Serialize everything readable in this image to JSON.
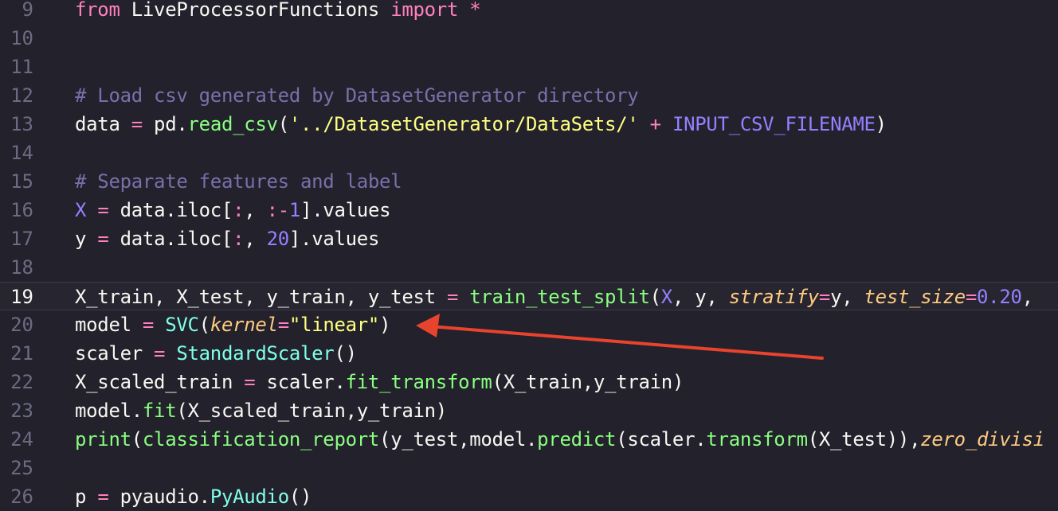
{
  "editor": {
    "lines": [
      {
        "n": "9",
        "tokens": [
          [
            "kw",
            "from"
          ],
          [
            "plain",
            " LiveProcessorFunctions "
          ],
          [
            "kw",
            "import"
          ],
          [
            "plain",
            " "
          ],
          [
            "op",
            "*"
          ]
        ]
      },
      {
        "n": "10",
        "tokens": []
      },
      {
        "n": "11",
        "tokens": []
      },
      {
        "n": "12",
        "tokens": [
          [
            "cmt",
            "# Load csv generated by DatasetGenerator directory"
          ]
        ]
      },
      {
        "n": "13",
        "tokens": [
          [
            "plain",
            "data "
          ],
          [
            "op",
            "="
          ],
          [
            "plain",
            " pd."
          ],
          [
            "fn",
            "read_csv"
          ],
          [
            "plain",
            "("
          ],
          [
            "str",
            "'../DatasetGenerator/DataSets/'"
          ],
          [
            "plain",
            " "
          ],
          [
            "op",
            "+"
          ],
          [
            "plain",
            " "
          ],
          [
            "var",
            "INPUT_CSV_FILENAME"
          ],
          [
            "plain",
            ")"
          ]
        ]
      },
      {
        "n": "14",
        "tokens": []
      },
      {
        "n": "15",
        "tokens": [
          [
            "cmt",
            "# Separate features and label"
          ]
        ]
      },
      {
        "n": "16",
        "tokens": [
          [
            "var",
            "X"
          ],
          [
            "plain",
            " "
          ],
          [
            "op",
            "="
          ],
          [
            "plain",
            " data.iloc["
          ],
          [
            "op",
            ":"
          ],
          [
            "plain",
            ", "
          ],
          [
            "op",
            ":-"
          ],
          [
            "num",
            "1"
          ],
          [
            "plain",
            "].values"
          ]
        ]
      },
      {
        "n": "17",
        "tokens": [
          [
            "plain",
            "y "
          ],
          [
            "op",
            "="
          ],
          [
            "plain",
            " data.iloc["
          ],
          [
            "op",
            ":"
          ],
          [
            "plain",
            ", "
          ],
          [
            "num",
            "20"
          ],
          [
            "plain",
            "].values"
          ]
        ]
      },
      {
        "n": "18",
        "tokens": []
      },
      {
        "n": "19",
        "current": true,
        "tokens": [
          [
            "plain",
            "X_train, X_test, y_train, y_test "
          ],
          [
            "op",
            "="
          ],
          [
            "plain",
            " "
          ],
          [
            "fn",
            "train_test_split"
          ],
          [
            "plain",
            "("
          ],
          [
            "var",
            "X"
          ],
          [
            "plain",
            ", y, "
          ],
          [
            "arg",
            "stratify"
          ],
          [
            "op",
            "="
          ],
          [
            "plain",
            "y, "
          ],
          [
            "arg",
            "test_size"
          ],
          [
            "op",
            "="
          ],
          [
            "num",
            "0.20"
          ],
          [
            "plain",
            ","
          ]
        ]
      },
      {
        "n": "20",
        "tokens": [
          [
            "plain",
            "model "
          ],
          [
            "op",
            "="
          ],
          [
            "plain",
            " "
          ],
          [
            "cls",
            "SVC"
          ],
          [
            "plain",
            "("
          ],
          [
            "arg",
            "kernel"
          ],
          [
            "op",
            "="
          ],
          [
            "str",
            "\"linear\""
          ],
          [
            "plain",
            ")"
          ]
        ]
      },
      {
        "n": "21",
        "tokens": [
          [
            "plain",
            "scaler "
          ],
          [
            "op",
            "="
          ],
          [
            "plain",
            " "
          ],
          [
            "cls",
            "StandardScaler"
          ],
          [
            "plain",
            "()"
          ]
        ]
      },
      {
        "n": "22",
        "tokens": [
          [
            "plain",
            "X_scaled_train "
          ],
          [
            "op",
            "="
          ],
          [
            "plain",
            " scaler."
          ],
          [
            "fn",
            "fit_transform"
          ],
          [
            "plain",
            "(X_train,y_train)"
          ]
        ]
      },
      {
        "n": "23",
        "tokens": [
          [
            "plain",
            "model."
          ],
          [
            "fn",
            "fit"
          ],
          [
            "plain",
            "(X_scaled_train,y_train)"
          ]
        ]
      },
      {
        "n": "24",
        "tokens": [
          [
            "fn",
            "print"
          ],
          [
            "plain",
            "("
          ],
          [
            "fn",
            "classification_report"
          ],
          [
            "plain",
            "(y_test,model."
          ],
          [
            "fn",
            "predict"
          ],
          [
            "plain",
            "(scaler."
          ],
          [
            "fn",
            "transform"
          ],
          [
            "plain",
            "(X_test)),"
          ],
          [
            "arg",
            "zero_divisi"
          ]
        ]
      },
      {
        "n": "25",
        "tokens": []
      },
      {
        "n": "26",
        "tokens": [
          [
            "plain",
            "p "
          ],
          [
            "op",
            "="
          ],
          [
            "plain",
            " pyaudio."
          ],
          [
            "cls",
            "PyAudio"
          ],
          [
            "plain",
            "()"
          ]
        ]
      }
    ]
  },
  "annotation": {
    "color": "#e8432c"
  }
}
